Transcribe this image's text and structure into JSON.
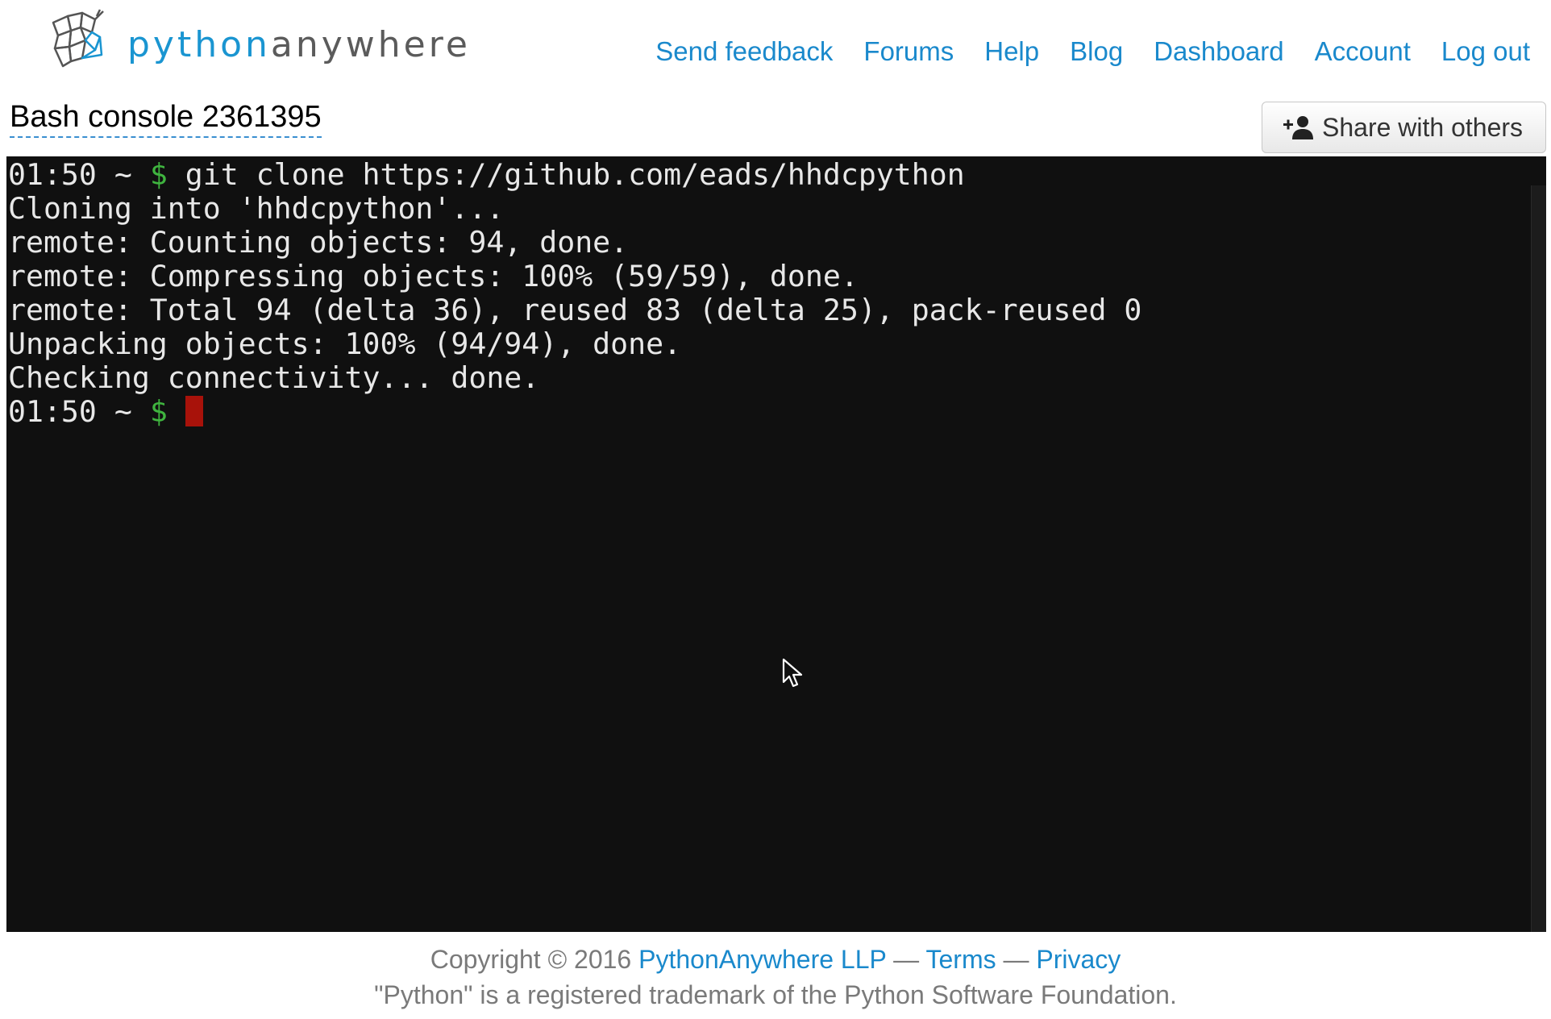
{
  "header": {
    "logo": {
      "part1": "python",
      "part2": "anywhere"
    },
    "nav": [
      {
        "label": "Send feedback"
      },
      {
        "label": "Forums"
      },
      {
        "label": "Help"
      },
      {
        "label": "Blog"
      },
      {
        "label": "Dashboard"
      },
      {
        "label": "Account"
      },
      {
        "label": "Log out"
      }
    ]
  },
  "console": {
    "title": "Bash console 2361395",
    "share_label": "Share with others"
  },
  "terminal": {
    "prompt": "01:50 ~ ",
    "dollar": "$",
    "command": " git clone https://github.com/eads/hhdcpython",
    "output": [
      "Cloning into 'hhdcpython'...",
      "remote: Counting objects: 94, done.",
      "remote: Compressing objects: 100% (59/59), done.",
      "remote: Total 94 (delta 36), reused 83 (delta 25), pack-reused 0",
      "Unpacking objects: 100% (94/94), done.",
      "Checking connectivity... done."
    ],
    "final_prompt": "01:50 ~ ",
    "final_dollar": "$",
    "colors": {
      "background": "#101010",
      "text": "#e8e8e8",
      "dollar": "#3fb43f",
      "cursor": "#a8120a"
    }
  },
  "footer": {
    "copyright": "Copyright © 2016 ",
    "company": "PythonAnywhere LLP",
    "sep1": " — ",
    "terms": "Terms",
    "sep2": " — ",
    "privacy": "Privacy",
    "trademark": "\"Python\" is a registered trademark of the Python Software Foundation."
  },
  "colors": {
    "link": "#1a89cc",
    "logo_blue": "#1a95d1",
    "logo_gray": "#5b5b5b"
  }
}
